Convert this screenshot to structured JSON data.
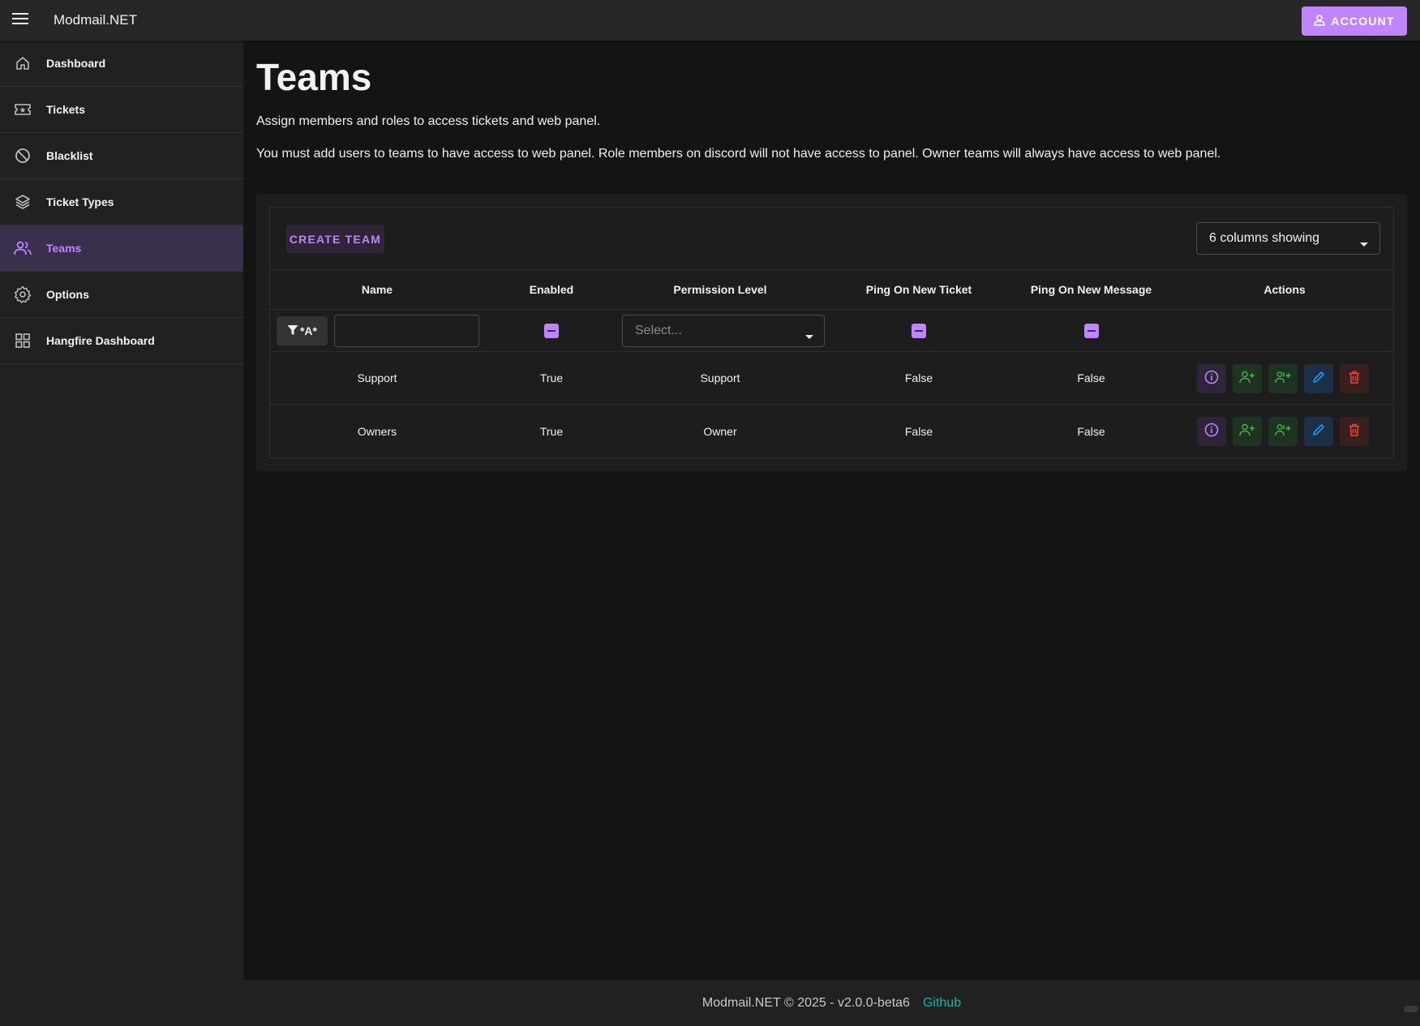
{
  "app": {
    "title": "Modmail.NET",
    "account_label": "ACCOUNT"
  },
  "colors": {
    "accent": "#c084fc",
    "green": "#4caf50",
    "blue": "#2196f3",
    "red": "#f44336",
    "link": "#1cb5a6"
  },
  "sidebar": {
    "items": [
      {
        "label": "Dashboard",
        "icon": "home-icon"
      },
      {
        "label": "Tickets",
        "icon": "ticket-icon"
      },
      {
        "label": "Blacklist",
        "icon": "block-icon"
      },
      {
        "label": "Ticket Types",
        "icon": "layers-icon"
      },
      {
        "label": "Teams",
        "icon": "people-icon",
        "active": true
      },
      {
        "label": "Options",
        "icon": "gear-icon"
      },
      {
        "label": "Hangfire Dashboard",
        "icon": "grid-icon"
      }
    ]
  },
  "page": {
    "title": "Teams",
    "desc1": "Assign members and roles to access tickets and web panel.",
    "desc2": "You must add users to teams to have access to web panel. Role members on discord will not have access to panel. Owner teams will always have access to web panel."
  },
  "toolbar": {
    "create_label": "CREATE TEAM",
    "columns_label": "6 columns showing"
  },
  "table": {
    "headers": [
      "Name",
      "Enabled",
      "Permission Level",
      "Ping On New Ticket",
      "Ping On New Message",
      "Actions"
    ],
    "filter": {
      "button_label": "*A*",
      "select_placeholder": "Select..."
    },
    "rows": [
      {
        "name": "Support",
        "enabled": "True",
        "permission": "Support",
        "ping_ticket": "False",
        "ping_message": "False"
      },
      {
        "name": "Owners",
        "enabled": "True",
        "permission": "Owner",
        "ping_ticket": "False",
        "ping_message": "False"
      }
    ]
  },
  "footer": {
    "text": "Modmail.NET © 2025 - v2.0.0-beta6",
    "link": "Github"
  }
}
